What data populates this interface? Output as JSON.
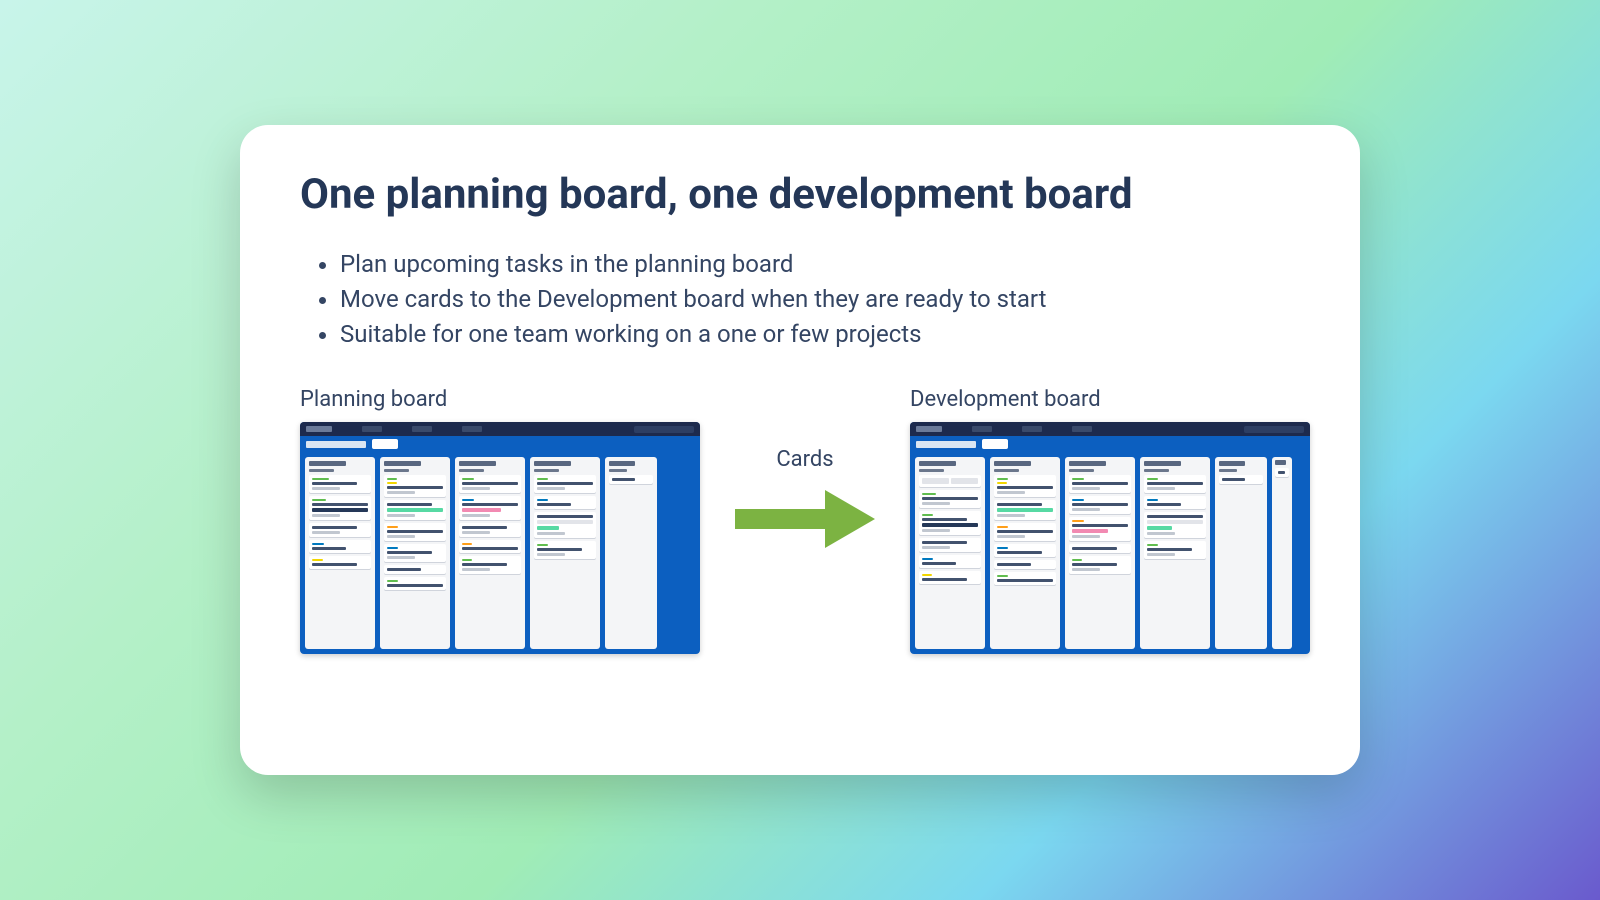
{
  "title": "One planning board, one development board",
  "bullets": [
    "Plan upcoming tasks in the planning board",
    "Move cards to the Development board when they are ready to start",
    "Suitable for one team working on a one or few projects"
  ],
  "left_board_label": "Planning board",
  "right_board_label": "Development board",
  "arrow_label": "Cards",
  "colors": {
    "heading": "#243757",
    "body": "#344563",
    "arrow": "#7cb342",
    "board_bg": "#0c5fc0"
  }
}
